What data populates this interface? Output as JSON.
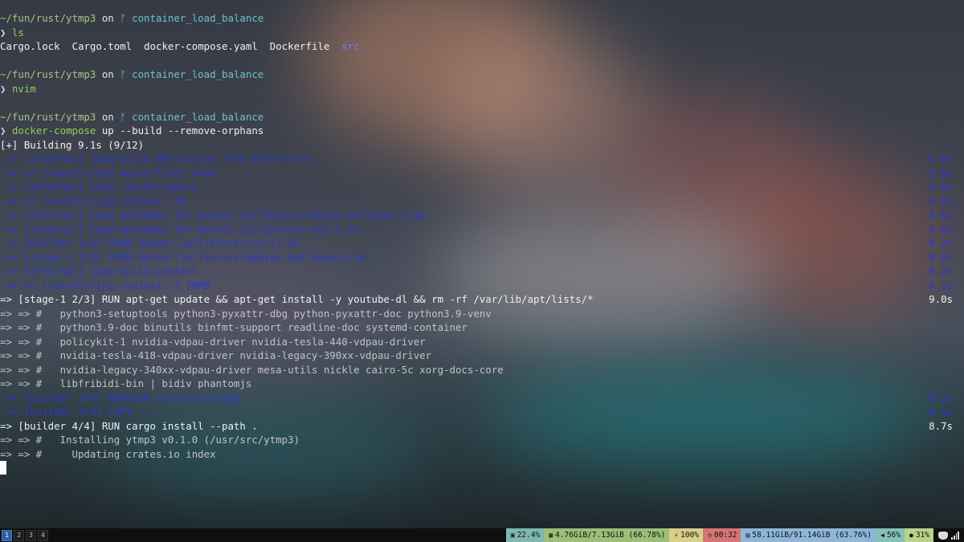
{
  "terminal": {
    "prompt_path": "~/fun/rust/ytmp3",
    "prompt_on": "on",
    "prompt_branch_icon": "ᚠ",
    "prompt_branch": "container_load_balance",
    "prompt_symbol": "❯",
    "cmd1": "ls",
    "ls_files": [
      "Cargo.lock",
      "Cargo.toml",
      "docker-compose.yaml",
      "Dockerfile"
    ],
    "ls_dir": "src",
    "cmd2": "nvim",
    "cmd3_name": "docker-compose",
    "cmd3_args": " up --build --remove-orphans",
    "building": "[+] Building 9.1s (9/12)",
    "build_lines": [
      {
        "text": " => [internal] load build definition from Dockerfile",
        "time": "0.0s",
        "style": "blue"
      },
      {
        "text": " => => transferring dockerfile: 441B",
        "time": "0.0s",
        "style": "blue"
      },
      {
        "text": " => [internal] load .dockerignore",
        "time": "0.0s",
        "style": "blue"
      },
      {
        "text": " => => transferring context: 2B",
        "time": "0.0s",
        "style": "blue"
      },
      {
        "text": " => [internal] load metadata for docker.io/library/debian:bullseye-slim",
        "time": "0.0s",
        "style": "blue"
      },
      {
        "text": " => [internal] load metadata for docker.io/library/rust:1.65",
        "time": "0.0s",
        "style": "blue"
      },
      {
        "text": " => [builder 1/4] FROM docker.io/library/rust:1.65",
        "time": "0.2s",
        "style": "blue"
      },
      {
        "text": " => [stage-1 1/3] FROM docker.io/library/debian:bullseye-slim",
        "time": "0.0s",
        "style": "blue"
      },
      {
        "text": " => [internal] load build context",
        "time": "0.2s",
        "style": "blue"
      },
      {
        "text": " => => transferring context: 3.78MB",
        "time": "0.1s",
        "style": "blue"
      },
      {
        "text": "=> [stage-1 2/3] RUN apt-get update && apt-get install -y youtube-dl && rm -rf /var/lib/apt/lists/*",
        "time": "9.0s",
        "style": "white"
      },
      {
        "text": "=> => #   python3-setuptools python3-pyxattr-dbg python-pyxattr-doc python3.9-venv",
        "time": "",
        "style": "gray"
      },
      {
        "text": "=> => #   python3.9-doc binutils binfmt-support readline-doc systemd-container",
        "time": "",
        "style": "gray"
      },
      {
        "text": "=> => #   policykit-1 nvidia-vdpau-driver nvidia-tesla-440-vdpau-driver",
        "time": "",
        "style": "gray"
      },
      {
        "text": "=> => #   nvidia-tesla-418-vdpau-driver nvidia-legacy-390xx-vdpau-driver",
        "time": "",
        "style": "gray"
      },
      {
        "text": "=> => #   nvidia-legacy-340xx-vdpau-driver mesa-utils nickle cairo-5c xorg-docs-core",
        "time": "",
        "style": "gray"
      },
      {
        "text": "=> => #   libfribidi-bin | bidiv phantomjs",
        "time": "",
        "style": "gray"
      },
      {
        "text": " => [builder 2/4] WORKDIR /usr/src/ytmp3",
        "time": "0.1s",
        "style": "blue"
      },
      {
        "text": " => [builder 3/4] COPY . .",
        "time": "0.1s",
        "style": "blue"
      },
      {
        "text": "=> [builder 4/4] RUN cargo install --path .",
        "time": "8.7s",
        "style": "white"
      },
      {
        "text": "=> => #   Installing ytmp3 v0.1.0 (/usr/src/ytmp3)",
        "time": "",
        "style": "gray"
      },
      {
        "text": "=> => #     Updating crates.io index",
        "time": "",
        "style": "gray"
      }
    ]
  },
  "statusbar": {
    "workspaces": [
      "1",
      "2",
      "3",
      "4"
    ],
    "active_workspace": "1",
    "modules": [
      {
        "name": "cpu",
        "icon": "cpu-icon",
        "glyph": "▣",
        "text": "22.4%",
        "color": "#7fb7b1"
      },
      {
        "name": "memory",
        "icon": "memory-icon",
        "glyph": "▦",
        "text": "4.76GiB/7.13GiB (66.78%)",
        "color": "#9bbf78"
      },
      {
        "name": "battery",
        "icon": "battery-icon",
        "glyph": "⚡",
        "text": "100%",
        "color": "#d8cf86"
      },
      {
        "name": "clock",
        "icon": "clock-icon",
        "glyph": "◷",
        "text": "00:32",
        "color": "#d87475"
      },
      {
        "name": "disk",
        "icon": "disk-icon",
        "glyph": "▤",
        "text": "58.11GiB/91.14GiB (63.76%)",
        "color": "#8fb6d8"
      },
      {
        "name": "volume",
        "icon": "volume-icon",
        "glyph": "◀",
        "text": "56%",
        "color": "#85c1b6"
      },
      {
        "name": "microphone",
        "icon": "microphone-icon",
        "glyph": "●",
        "text": "31%",
        "color": "#b8d28b"
      }
    ]
  }
}
